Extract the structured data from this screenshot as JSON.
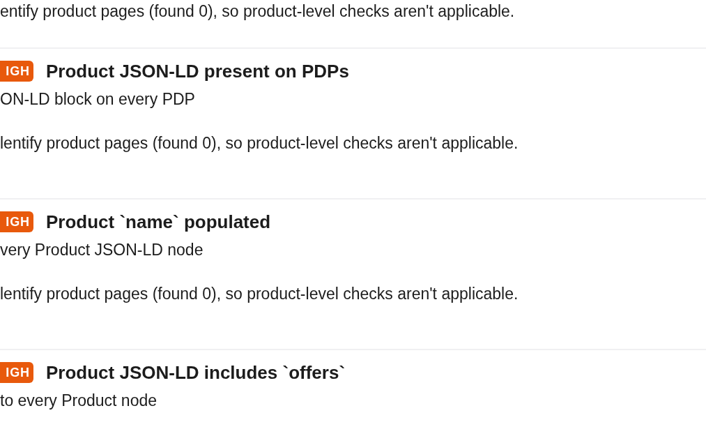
{
  "top_note": "entify product pages (found 0), so product-level checks aren't applicable.",
  "checks": [
    {
      "severity": "IGH",
      "title": "Product JSON-LD present on PDPs",
      "description": "ON-LD block on every PDP",
      "note": "lentify product pages (found 0), so product-level checks aren't applicable."
    },
    {
      "severity": "IGH",
      "title": "Product `name` populated",
      "description": "very Product JSON-LD node",
      "note": "lentify product pages (found 0), so product-level checks aren't applicable."
    },
    {
      "severity": "IGH",
      "title": "Product JSON-LD includes `offers`",
      "description": "to every Product node"
    }
  ]
}
